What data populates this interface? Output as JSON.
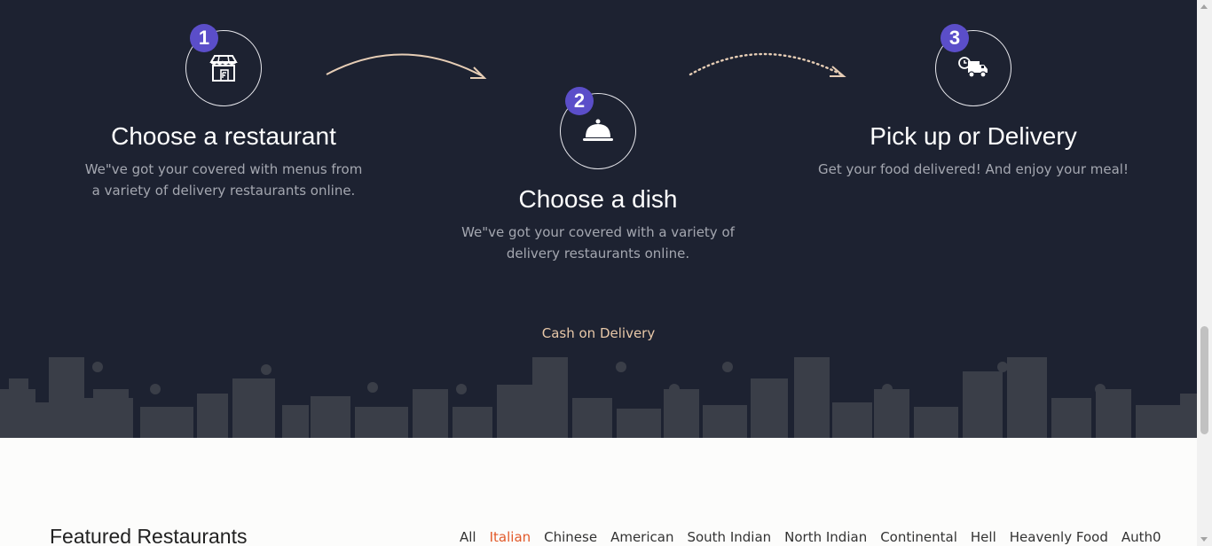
{
  "steps": [
    {
      "number": "1",
      "title": "Choose a restaurant",
      "description": "We\"ve got your covered with menus from a variety of delivery restaurants online.",
      "icon": "storefront-icon"
    },
    {
      "number": "2",
      "title": "Choose a dish",
      "description": "We\"ve got your covered with a variety of delivery restaurants online.",
      "icon": "cloche-icon"
    },
    {
      "number": "3",
      "title": "Pick up or Delivery",
      "description": "Get your food delivered! And enjoy your meal!",
      "icon": "delivery-truck-icon"
    }
  ],
  "payment": {
    "label": "Cash on Delivery"
  },
  "featured": {
    "title": "Featured Restaurants",
    "filters": [
      "All",
      "Italian",
      "Chinese",
      "American",
      "South Indian",
      "North Indian",
      "Continental",
      "Hell",
      "Heavenly Food",
      "Auth0"
    ],
    "active_filter": "Italian"
  },
  "colors": {
    "section_bg": "#1d2231",
    "badge": "#5b4ec9",
    "accent": "#e25a2a",
    "cod_text": "#e8c8a8",
    "arrow": "#e6cdb5"
  }
}
